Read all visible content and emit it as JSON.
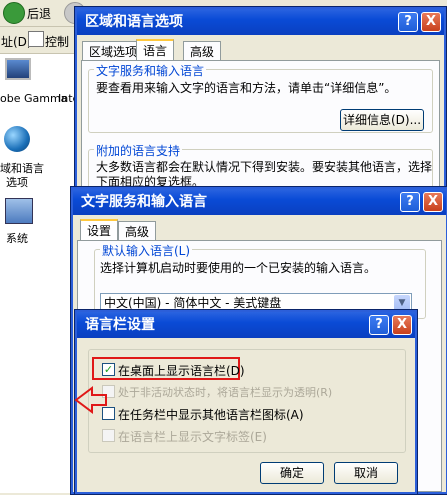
{
  "explorer": {
    "back_label": "后退",
    "address_label": "址(D)",
    "control_label": "控制",
    "desktop_icons": [
      {
        "label": "obe Gamma"
      },
      {
        "label": "Inte"
      },
      {
        "label": "域和语言"
      },
      {
        "label": "选项"
      },
      {
        "label": "系统"
      }
    ]
  },
  "region_window": {
    "title": "区域和语言选项",
    "help_btn": "?",
    "close_btn": "X",
    "tabs": [
      {
        "label": "区域选项"
      },
      {
        "label": "语言"
      },
      {
        "label": "高级"
      }
    ],
    "group1_title": "文字服务和输入语言",
    "group1_text": "要查看用来输入文字的语言和方法，请单击“详细信息”。",
    "details_button": "详细信息(D)...",
    "group2_title": "附加的语言支持",
    "group2_text_line1": "大多数语言都会在默认情况下得到安装。要安装其他语言，选择",
    "group2_text_line2": "下面相应的复选框。"
  },
  "textsvc_window": {
    "title": "文字服务和输入语言",
    "help_btn": "?",
    "close_btn": "X",
    "tabs": [
      {
        "label": "设置"
      },
      {
        "label": "高级"
      }
    ],
    "group_title": "默认输入语言(L)",
    "group_text": "选择计算机启动时要使用的一个已安装的输入语言。",
    "combo_value": "中文(中国) - 简体中文 - 美式键盘"
  },
  "langbar_dialog": {
    "title": "语言栏设置",
    "help_btn": "?",
    "close_btn": "X",
    "options": [
      {
        "label": "在桌面上显示语言栏(D)",
        "checked": true,
        "enabled": true
      },
      {
        "label": "处于非活动状态时，将语言栏显示为透明(R)",
        "checked": false,
        "enabled": false
      },
      {
        "label": "在任务栏中显示其他语言栏图标(A)",
        "checked": false,
        "enabled": true
      },
      {
        "label": "在语言栏上显示文字标签(E)",
        "checked": false,
        "enabled": false
      }
    ],
    "ok_button": "确定",
    "cancel_button": "取消"
  },
  "colors": {
    "title_blue": "#0a4bd6",
    "highlight_red": "#e01818",
    "group_label_blue": "#0046d5"
  }
}
